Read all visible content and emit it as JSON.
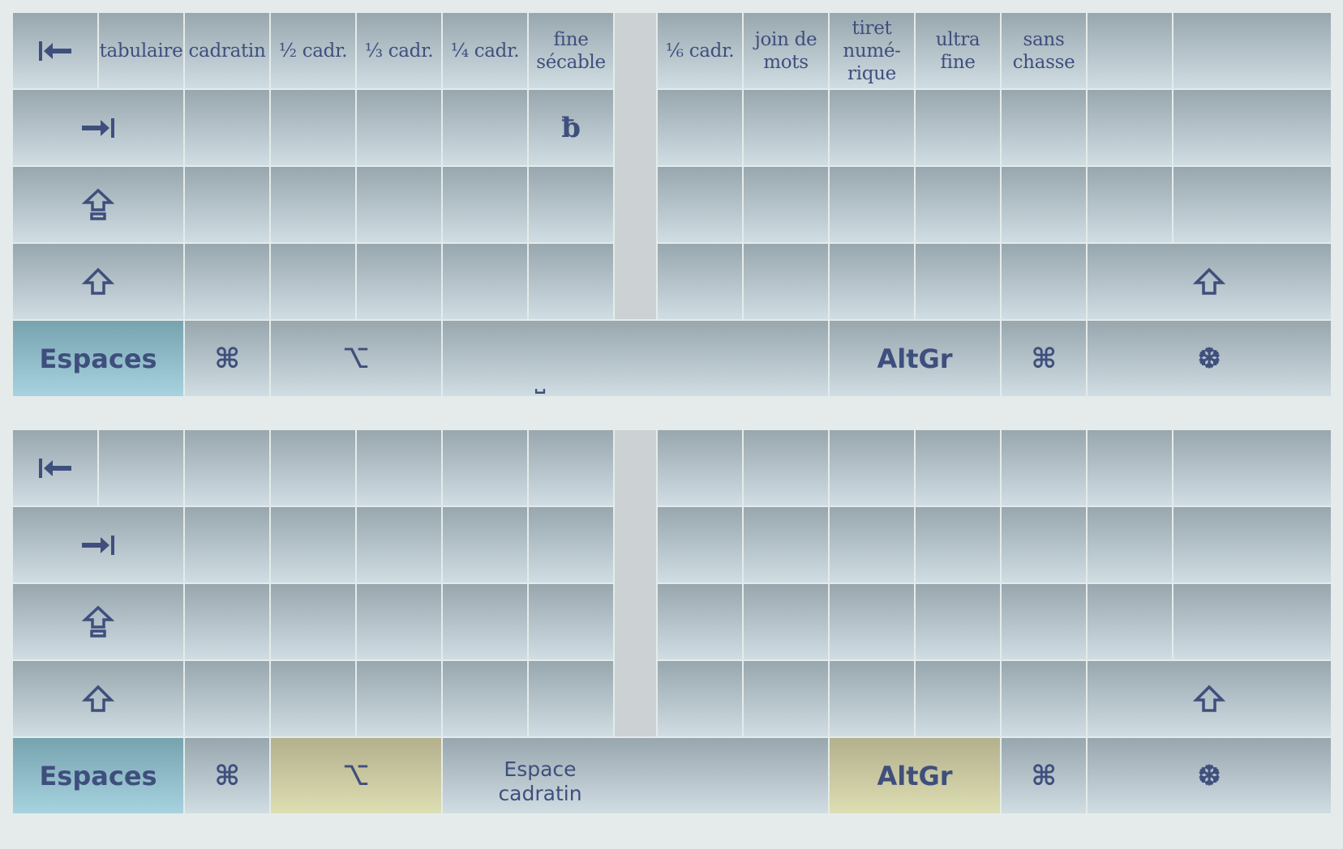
{
  "colors": {
    "page_bg": "#e4ebea",
    "key_gradient_top": "#98a6ae",
    "key_gradient_bottom": "#d0dde3",
    "label_color": "#3f4f7d",
    "espaces_key": "#8fbfcc",
    "active_modifier": "#cfcca0",
    "split_gap": "#ccd1d4"
  },
  "layer1": {
    "number_row": {
      "tab_left_icon": "tab-left-icon",
      "keys": [
        "tabulaire",
        "cadratin",
        "½ cadr.",
        "⅓ cadr.",
        "¼ cadr.",
        "fine\nsécable",
        "⅙ cadr.",
        "join de\nmots",
        "tiret\nnumé-\nrique",
        "ultra\nfine",
        "sans\nchasse",
        "",
        ""
      ]
    },
    "top_row": {
      "tab_icon": "tab-right-icon",
      "fine_key_char": "ƀ"
    },
    "home_row": {
      "capslock_icon": "capslock-icon"
    },
    "shift_row": {
      "shift_icon": "shift-icon"
    },
    "bottom_row": {
      "espaces": "Espaces",
      "command": "⌘",
      "option": "⌥",
      "space_char": "⎵",
      "altgr": "AltGr",
      "command_right": "⌘",
      "menu": "❆"
    }
  },
  "layer2": {
    "bottom_row": {
      "espaces": "Espaces",
      "command": "⌘",
      "option": "⌥",
      "space_label": "Espace\ncadratin",
      "altgr": "AltGr",
      "command_right": "⌘",
      "menu": "❆"
    }
  }
}
